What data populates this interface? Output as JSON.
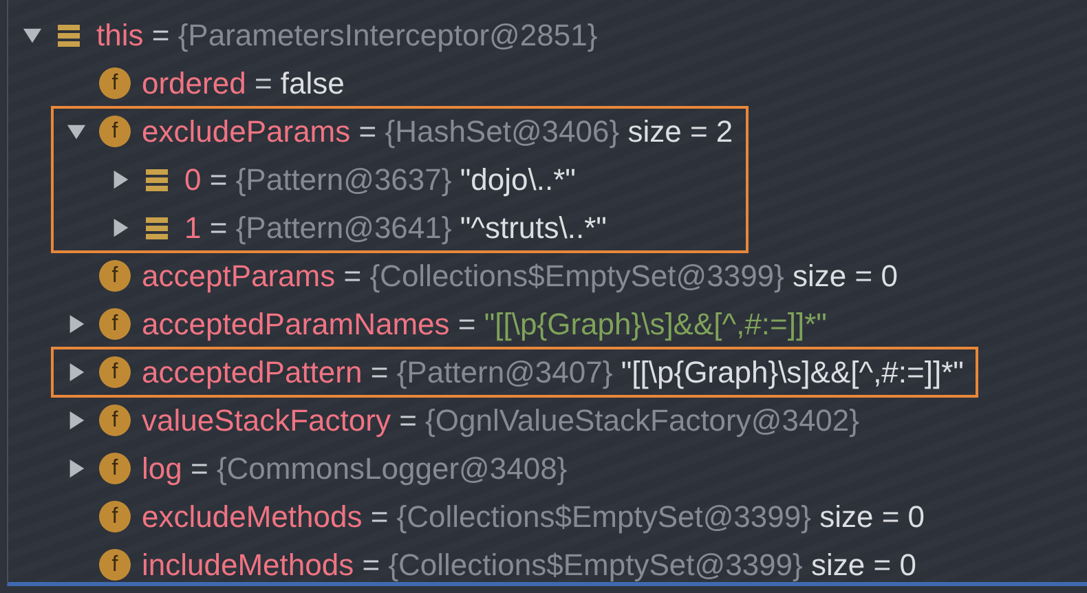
{
  "variables": [
    {
      "kind": "object",
      "name": "this",
      "separator": "=",
      "type": "{ParametersInterceptor@2851}",
      "expanded": true,
      "children": [
        {
          "kind": "field",
          "badge": "f",
          "name": "ordered",
          "separator": "=",
          "value": "false"
        },
        {
          "kind": "field",
          "badge": "f",
          "name": "excludeParams",
          "separator": "=",
          "type": "{HashSet@3406}",
          "value": "size = 2",
          "expanded": true,
          "highlighted": true,
          "children": [
            {
              "kind": "object",
              "name": "0",
              "separator": "=",
              "type": "{Pattern@3637}",
              "value": "\"dojo\\..*\"",
              "expanded": false
            },
            {
              "kind": "object",
              "name": "1",
              "separator": "=",
              "type": "{Pattern@3641}",
              "value": "\"^struts\\..*\"",
              "expanded": false
            }
          ]
        },
        {
          "kind": "field",
          "badge": "f",
          "name": "acceptParams",
          "separator": "=",
          "type": "{Collections$EmptySet@3399}",
          "value": "size = 0"
        },
        {
          "kind": "field",
          "badge": "f",
          "name": "acceptedParamNames",
          "separator": "=",
          "string_value": "\"[[\\p{Graph}\\s]&&[^,#:=]]*\"",
          "expanded": false
        },
        {
          "kind": "field",
          "badge": "f",
          "name": "acceptedPattern",
          "separator": "=",
          "type": "{Pattern@3407}",
          "value": "\"[[\\p{Graph}\\s]&&[^,#:=]]*\"",
          "expanded": false,
          "highlighted": true
        },
        {
          "kind": "field",
          "badge": "f",
          "name": "valueStackFactory",
          "separator": "=",
          "type": "{OgnlValueStackFactory@3402}",
          "expanded": false
        },
        {
          "kind": "field",
          "badge": "f",
          "name": "log",
          "separator": "=",
          "type": "{CommonsLogger@3408}",
          "expanded": false
        },
        {
          "kind": "field",
          "badge": "f",
          "name": "excludeMethods",
          "separator": "=",
          "type": "{Collections$EmptySet@3399}",
          "value": "size = 0"
        },
        {
          "kind": "field",
          "badge": "f",
          "name": "includeMethods",
          "separator": "=",
          "type": "{Collections$EmptySet@3399}",
          "value": "size = 0"
        }
      ]
    }
  ]
}
